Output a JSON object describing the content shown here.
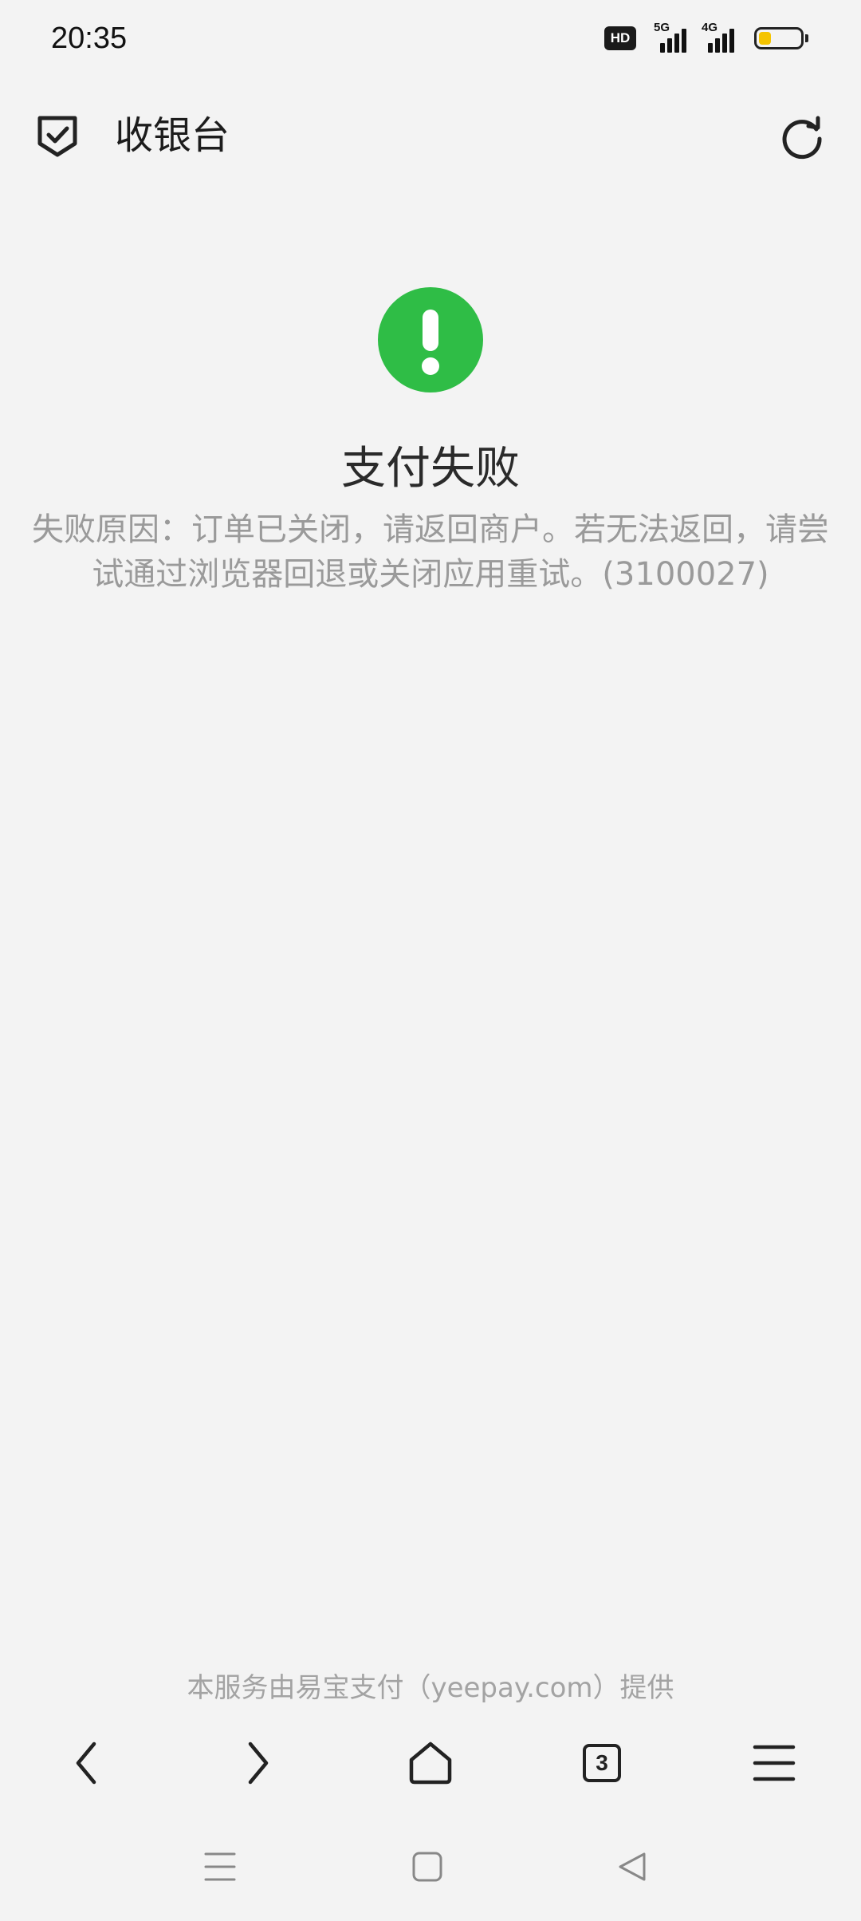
{
  "status_bar": {
    "time": "20:35",
    "hd_label": "HD",
    "network_1": "5G",
    "network_2": "4G",
    "battery_level": 0.3,
    "battery_color": "#f5c400"
  },
  "header": {
    "title": "收银台",
    "left_icon": "shield-check-icon",
    "right_icon": "refresh-icon"
  },
  "result": {
    "icon": "exclamation-icon",
    "icon_color": "#2fbd46",
    "title": "支付失败",
    "reason": "失败原因：订单已关闭，请返回商户。若无法返回，请尝试通过浏览器回退或关闭应用重试。(3100027)"
  },
  "footer": {
    "provider": "本服务由易宝支付（yeepay.com）提供"
  },
  "browser_toolbar": {
    "tab_count": "3",
    "buttons": [
      "back-icon",
      "forward-icon",
      "home-icon",
      "tabs-icon",
      "menu-icon"
    ]
  },
  "system_nav": {
    "buttons": [
      "recent-apps-icon",
      "home-square-icon",
      "back-triangle-icon"
    ]
  }
}
